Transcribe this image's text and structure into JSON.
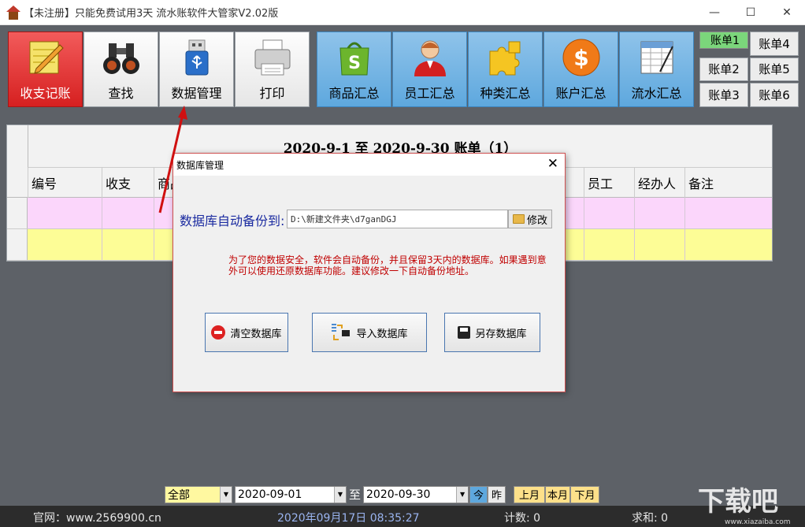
{
  "window": {
    "title": "【未注册】只能免费试用3天  流水账软件大管家V2.02版",
    "controls": {
      "minimize": "—",
      "maximize": "☐",
      "close": "✕"
    }
  },
  "toolbar": {
    "buttons": [
      {
        "label": "收支记账",
        "icon": "notepad-pencil-icon",
        "active": true
      },
      {
        "label": "查找",
        "icon": "binoculars-icon"
      },
      {
        "label": "数据管理",
        "icon": "usb-drive-icon"
      },
      {
        "label": "打印",
        "icon": "printer-icon"
      },
      {
        "label": "商品汇总",
        "icon": "shopping-bag-icon"
      },
      {
        "label": "员工汇总",
        "icon": "person-icon"
      },
      {
        "label": "种类汇总",
        "icon": "puzzle-icon"
      },
      {
        "label": "账户汇总",
        "icon": "dollar-coin-icon"
      },
      {
        "label": "流水汇总",
        "icon": "spreadsheet-icon"
      }
    ],
    "accounts": [
      "账单1",
      "账单4",
      "账单2",
      "账单5",
      "账单3",
      "账单6"
    ],
    "selected_account": "账单1"
  },
  "table": {
    "title": "2020-9-1  至  2020-9-30  账单（1）",
    "columns": [
      "编号",
      "收支",
      "商品",
      "员工",
      "经办人",
      "备注"
    ],
    "row_colors": [
      "#fbd6fb",
      "#fdfd96"
    ]
  },
  "dialog": {
    "title": "数据库管理",
    "close": "✕",
    "backup_label": "数据库自动备份到:",
    "backup_path": "D:\\新建文件夹\\d7ganDGJ",
    "modify_button": "修改",
    "note": "为了您的数据安全，软件会自动备份，并且保留3天内的数据库。如果遇到意外可以使用还原数据库功能。建议修改一下自动备份地址。",
    "buttons": {
      "clear": "清空数据库",
      "import": "导入数据库",
      "save_as": "另存数据库"
    }
  },
  "filter": {
    "scope": "全部",
    "start_date": "2020-09-01",
    "to": "至",
    "end_date": "2020-09-30",
    "today": "今",
    "yesterday": "昨",
    "last_month": "上月",
    "this_month": "本月",
    "next_month": "下月"
  },
  "status": {
    "website": "官网：www.2569900.cn",
    "datetime": "2020年09月17日  08:35:27",
    "count": "计数:  0",
    "sum": "求和:  0"
  },
  "watermark": {
    "text": "下载吧",
    "sub": "www.xiazaiba.com"
  }
}
